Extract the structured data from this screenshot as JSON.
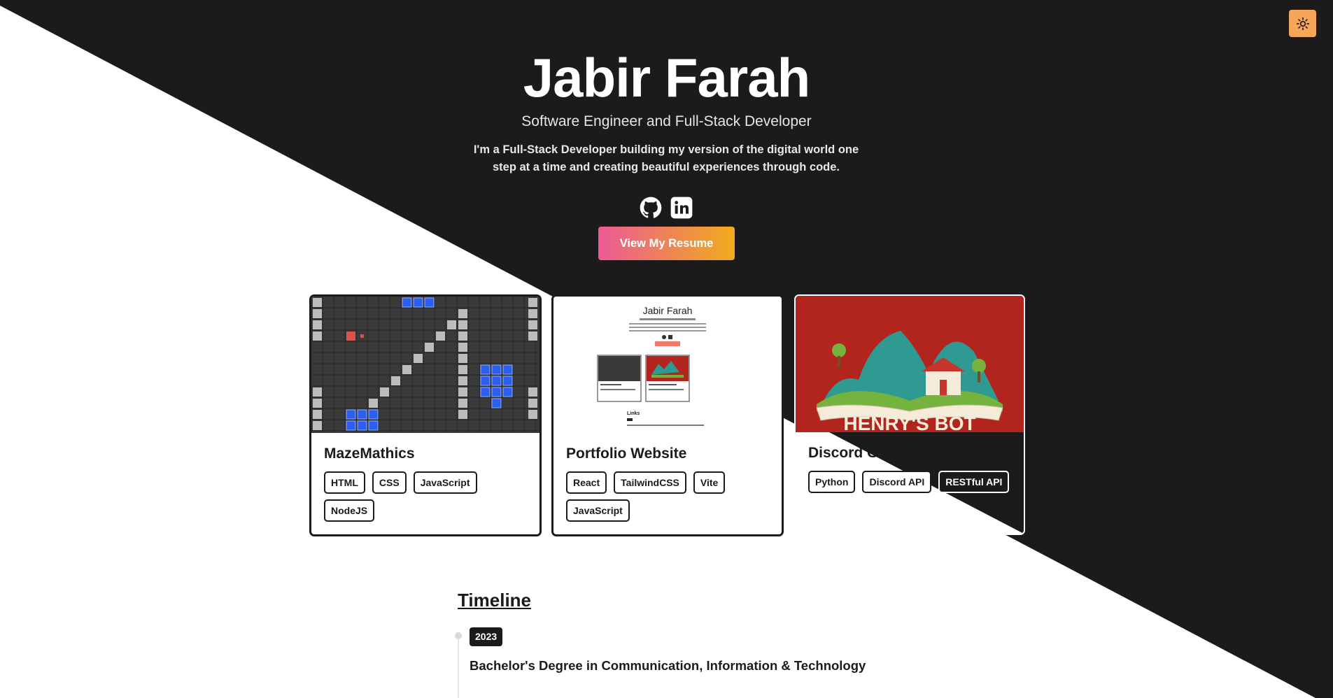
{
  "header": {
    "name": "Jabir Farah",
    "subtitle": "Software Engineer and Full-Stack Developer",
    "bio": "I'm a Full-Stack Developer building my version of the digital world one step at a time and creating beautiful experiences through code.",
    "resume_button": "View My Resume",
    "socials": [
      {
        "name": "GitHub",
        "icon": "github-icon"
      },
      {
        "name": "LinkedIn",
        "icon": "linkedin-icon"
      }
    ],
    "theme_toggle_icon": "sun-icon"
  },
  "projects": [
    {
      "title": "MazeMathics",
      "tags": [
        "HTML",
        "CSS",
        "JavaScript",
        "NodeJS"
      ]
    },
    {
      "title": "Portfolio Website",
      "tags": [
        "React",
        "TailwindCSS",
        "Vite",
        "JavaScript"
      ],
      "thumb_text": {
        "name": "Jabir Farah",
        "section": "Links"
      }
    },
    {
      "title": "Discord Geography Bot",
      "tags": [
        "Python",
        "Discord API",
        "RESTful API"
      ],
      "thumb_text": {
        "banner": "HENRY'S BOT"
      }
    }
  ],
  "timeline": {
    "title": "Timeline",
    "items": [
      {
        "year": "2023",
        "title": "Bachelor's Degree in Communication, Information & Technology"
      }
    ]
  },
  "colors": {
    "dark": "#1c1a1a",
    "light": "#ffffff",
    "accent_pink": "#ec5a95",
    "accent_amber": "#f0ac1c",
    "theme_button": "#f5a657"
  }
}
